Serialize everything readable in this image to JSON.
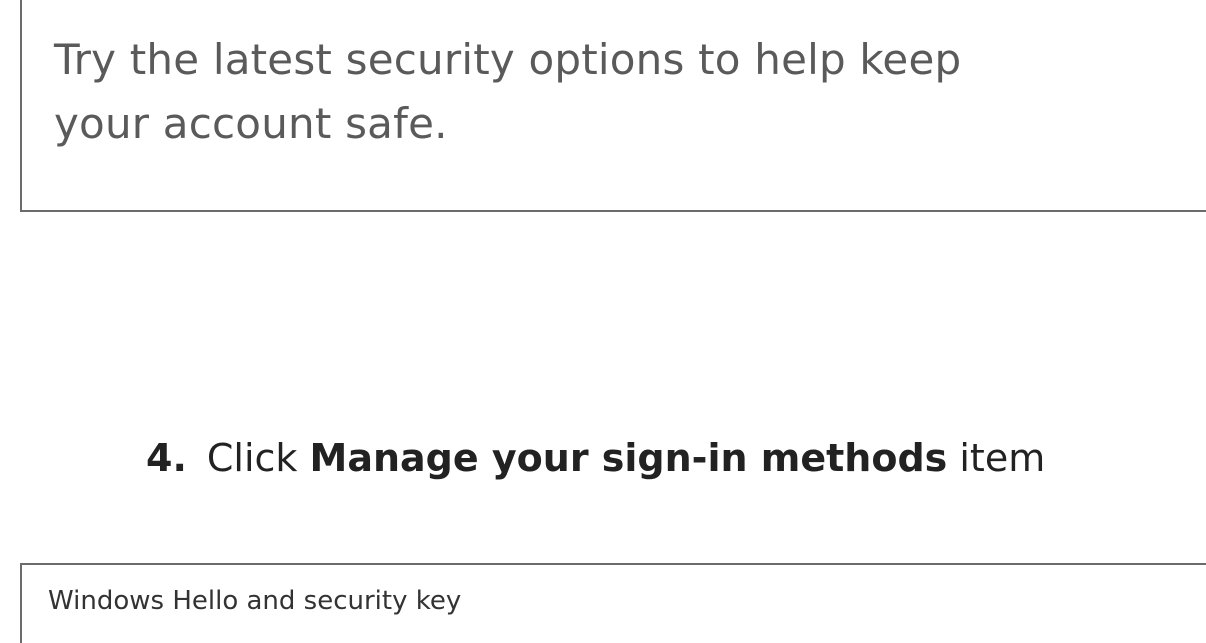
{
  "top_panel": {
    "description_line1": "Try the latest security options to help keep",
    "description_line2": "your account safe."
  },
  "step": {
    "number": "4.",
    "prefix": "Click",
    "highlight": "Manage your sign-in methods",
    "suffix": "item"
  },
  "bottom_panel": {
    "partial_text": "Windows Hello and security key"
  },
  "colors": {
    "frame_border": "#6b6b6b",
    "tip_text": "#5a5a5a",
    "body_text": "#222222"
  }
}
